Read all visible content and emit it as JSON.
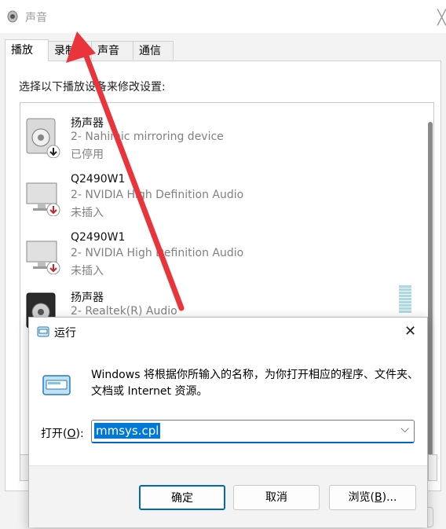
{
  "sound_dialog": {
    "title": "声音",
    "tabs": [
      {
        "label": "播放"
      },
      {
        "label": "录制"
      },
      {
        "label": "声音"
      },
      {
        "label": "通信"
      }
    ],
    "instruction": "选择以下播放设备来修改设置:",
    "devices": [
      {
        "name": "扬声器",
        "description": "2- Nahimic mirroring device",
        "status": "已停用",
        "icon": "speaker-icon",
        "badge": "down-arrow-icon"
      },
      {
        "name": "Q2490W1",
        "description": "2- NVIDIA High Definition Audio",
        "status": "未插入",
        "icon": "monitor-icon",
        "badge": "red-down-arrow-icon"
      },
      {
        "name": "Q2490W1",
        "description": "2- NVIDIA High Definition Audio",
        "status": "未插入",
        "icon": "monitor-icon",
        "badge": "red-down-arrow-icon"
      },
      {
        "name": "扬声器",
        "description": "2- Realtek(R) Audio",
        "status": "",
        "icon": "speaker-icon",
        "badge": ""
      }
    ]
  },
  "run_dialog": {
    "title": "运行",
    "message": "Windows 将根据你所输入的名称，为你打开相应的程序、文件夹、文档或 Internet 资源。",
    "open_label": "打开(",
    "open_hotkey": "O",
    "open_label_end": "):",
    "input_value": "mmsys.cpl",
    "buttons": {
      "ok": "确定",
      "cancel": "取消",
      "browse": "浏览(",
      "browse_hotkey": "B",
      "browse_end": ")..."
    }
  },
  "colors": {
    "arrow": "#e8343a",
    "accent": "#0067c0",
    "selection": "#0078d7"
  }
}
